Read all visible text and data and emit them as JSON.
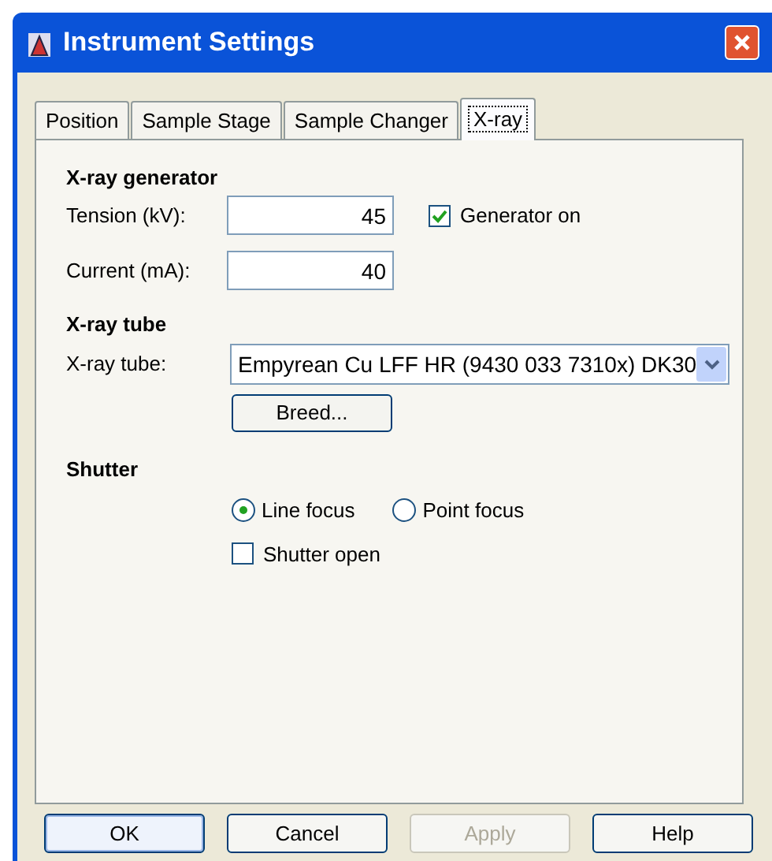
{
  "window": {
    "title": "Instrument Settings"
  },
  "tabs": [
    {
      "label": "Position",
      "selected": false
    },
    {
      "label": "Sample Stage",
      "selected": false
    },
    {
      "label": "Sample Changer",
      "selected": false
    },
    {
      "label": "X-ray",
      "selected": true
    }
  ],
  "generator": {
    "heading": "X-ray generator",
    "tension": {
      "label": "Tension (kV):",
      "value": "45"
    },
    "current": {
      "label": "Current (mA):",
      "value": "40"
    },
    "generator_on": {
      "label": "Generator on",
      "checked": true
    }
  },
  "tube": {
    "heading": "X-ray tube",
    "label": "X-ray tube:",
    "value": "Empyrean Cu LFF HR (9430 033 7310x) DK30",
    "browse_button": "Breed..."
  },
  "shutter": {
    "heading": "Shutter",
    "focus": [
      {
        "label": "Line focus",
        "selected": true
      },
      {
        "label": "Point focus",
        "selected": false
      }
    ],
    "shutter_open": {
      "label": "Shutter open",
      "checked": false
    }
  },
  "buttons": [
    {
      "label": "OK",
      "disabled": false,
      "default": true
    },
    {
      "label": "Cancel",
      "disabled": false,
      "default": false
    },
    {
      "label": "Apply",
      "disabled": true,
      "default": false
    },
    {
      "label": "Help",
      "disabled": false,
      "default": false
    }
  ]
}
